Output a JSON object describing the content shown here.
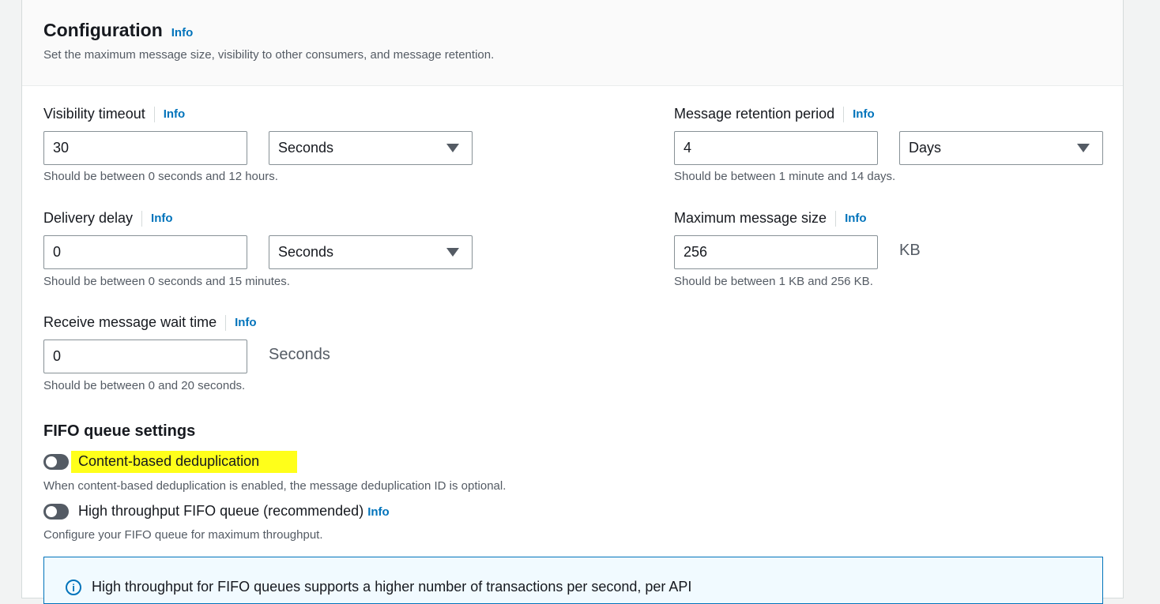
{
  "header": {
    "title": "Configuration",
    "info": "Info",
    "description": "Set the maximum message size, visibility to other consumers, and message retention."
  },
  "visibility_timeout": {
    "label": "Visibility timeout",
    "info": "Info",
    "value": "30",
    "unit": "Seconds",
    "hint": "Should be between 0 seconds and 12 hours."
  },
  "message_retention": {
    "label": "Message retention period",
    "info": "Info",
    "value": "4",
    "unit": "Days",
    "hint": "Should be between 1 minute and 14 days."
  },
  "delivery_delay": {
    "label": "Delivery delay",
    "info": "Info",
    "value": "0",
    "unit": "Seconds",
    "hint": "Should be between 0 seconds and 15 minutes."
  },
  "max_message_size": {
    "label": "Maximum message size",
    "info": "Info",
    "value": "256",
    "unit": "KB",
    "hint": "Should be between 1 KB and 256 KB."
  },
  "receive_wait_time": {
    "label": "Receive message wait time",
    "info": "Info",
    "value": "0",
    "unit": "Seconds",
    "hint": "Should be between 0 and 20 seconds."
  },
  "fifo": {
    "title": "FIFO queue settings",
    "content_dedup": {
      "label": "Content-based deduplication",
      "enabled": false,
      "description": "When content-based deduplication is enabled, the message deduplication ID is optional.",
      "highlight_color": "#ffff1a"
    },
    "high_throughput": {
      "label": "High throughput FIFO queue (recommended)",
      "info": "Info",
      "enabled": false,
      "description": "Configure your FIFO queue for maximum throughput."
    },
    "alert": {
      "icon": "info-circle-icon",
      "text": "High throughput for FIFO queues supports a higher number of transactions per second, per API"
    }
  },
  "colors": {
    "link": "#0073bb",
    "toggle_off": "#545b64",
    "alert_border": "#0073bb",
    "alert_bg": "#f1faff"
  }
}
